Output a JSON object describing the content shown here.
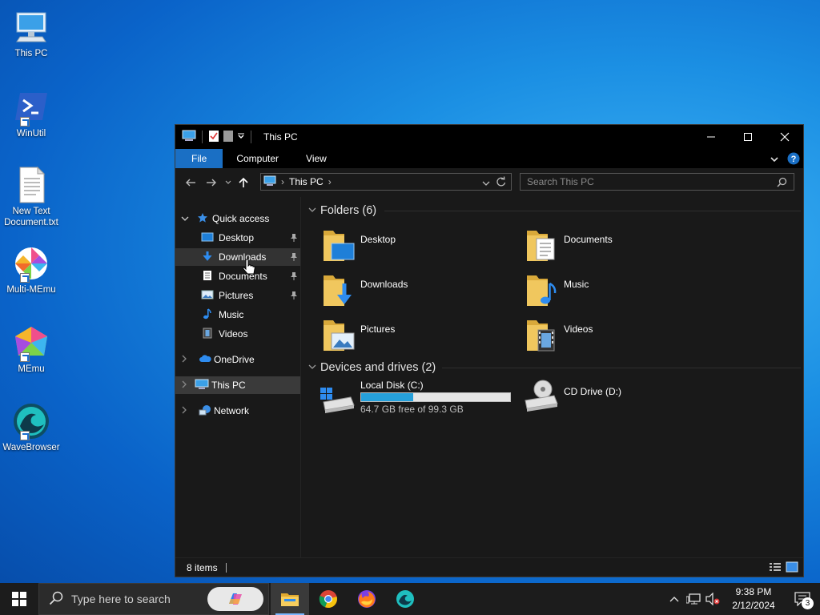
{
  "desktop": {
    "icons": [
      {
        "label": "This PC"
      },
      {
        "label": "WinUtil"
      },
      {
        "label": "New Text Document.txt"
      },
      {
        "label": "Multi-MEmu"
      },
      {
        "label": "MEmu"
      },
      {
        "label": "WaveBrowser"
      }
    ]
  },
  "window": {
    "title": "This PC",
    "ribbon_tabs": [
      "File",
      "Computer",
      "View"
    ],
    "address": {
      "location": "This PC"
    },
    "search": {
      "placeholder": "Search This PC"
    },
    "nav": {
      "quick_access": "Quick access",
      "items": [
        "Desktop",
        "Downloads",
        "Documents",
        "Pictures",
        "Music",
        "Videos"
      ],
      "onedrive": "OneDrive",
      "this_pc": "This PC",
      "network": "Network"
    },
    "folders_header": "Folders (6)",
    "folders": [
      "Desktop",
      "Documents",
      "Downloads",
      "Music",
      "Pictures",
      "Videos"
    ],
    "devices_header": "Devices and drives (2)",
    "drives": [
      {
        "name": "Local Disk (C:)",
        "free": "64.7 GB free of 99.3 GB",
        "used_fraction": 0.348
      },
      {
        "name": "CD Drive (D:)"
      }
    ],
    "status": "8 items"
  },
  "taskbar": {
    "search_placeholder": "Type here to search",
    "time": "9:38 PM",
    "date": "2/12/2024",
    "notification_count": "3"
  },
  "colors": {
    "accent": "#1a6fc4",
    "drive_fill": "#26a0da",
    "window_bg": "#191919",
    "folder_yellow": "#f0c75e"
  }
}
